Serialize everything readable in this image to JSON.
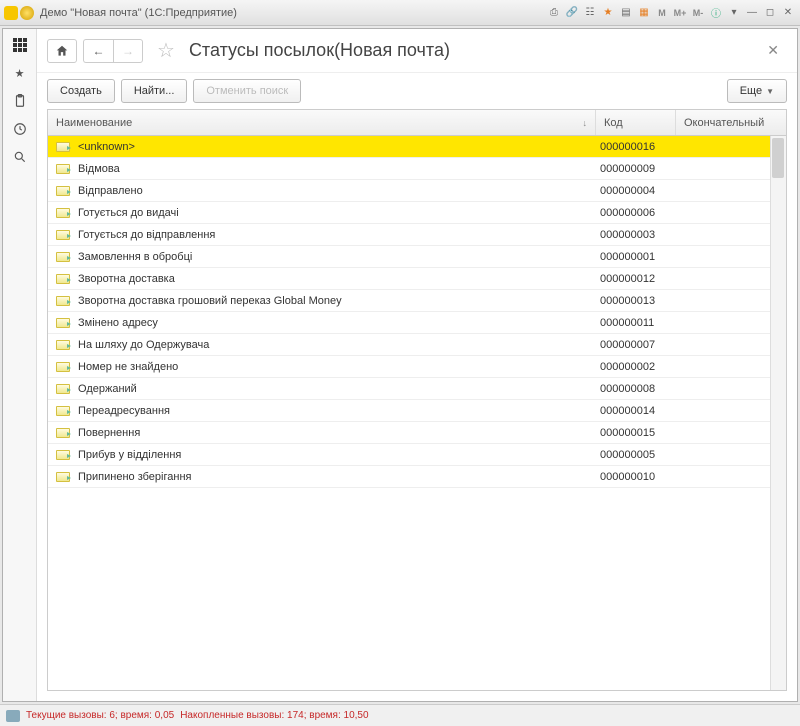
{
  "window": {
    "title": "Демо \"Новая почта\"  (1С:Предприятие)"
  },
  "titlebar_buttons": {
    "m": "M",
    "mplus": "M+",
    "mminus": "M-"
  },
  "page": {
    "title": "Статусы посылок(Новая почта)"
  },
  "toolbar": {
    "create": "Создать",
    "find": "Найти...",
    "cancel_search": "Отменить поиск",
    "more": "Еще"
  },
  "table": {
    "headers": {
      "name": "Наименование",
      "code": "Код",
      "final": "Окончательный"
    },
    "sort_indicator": "↓",
    "rows": [
      {
        "name": "<unknown>",
        "code": "000000016",
        "selected": true
      },
      {
        "name": "Відмова",
        "code": "000000009",
        "selected": false
      },
      {
        "name": "Відправлено",
        "code": "000000004",
        "selected": false
      },
      {
        "name": "Готується до видачі",
        "code": "000000006",
        "selected": false
      },
      {
        "name": "Готується до відправлення",
        "code": "000000003",
        "selected": false
      },
      {
        "name": "Замовлення в обробці",
        "code": "000000001",
        "selected": false
      },
      {
        "name": "Зворотна доставка",
        "code": "000000012",
        "selected": false
      },
      {
        "name": "Зворотна доставка грошовий переказ Global Money",
        "code": "000000013",
        "selected": false
      },
      {
        "name": "Змінено адресу",
        "code": "000000011",
        "selected": false
      },
      {
        "name": "На шляху до Одержувача",
        "code": "000000007",
        "selected": false
      },
      {
        "name": "Номер не знайдено",
        "code": "000000002",
        "selected": false
      },
      {
        "name": "Одержаний",
        "code": "000000008",
        "selected": false
      },
      {
        "name": "Переадресування",
        "code": "000000014",
        "selected": false
      },
      {
        "name": "Повернення",
        "code": "000000015",
        "selected": false
      },
      {
        "name": "Прибув у відділення",
        "code": "000000005",
        "selected": false
      },
      {
        "name": "Припинено зберігання",
        "code": "000000010",
        "selected": false
      }
    ]
  },
  "statusbar": {
    "current": "Текущие вызовы: 6; время: 0,05",
    "accumulated": "Накопленные вызовы: 174; время: 10,50"
  }
}
